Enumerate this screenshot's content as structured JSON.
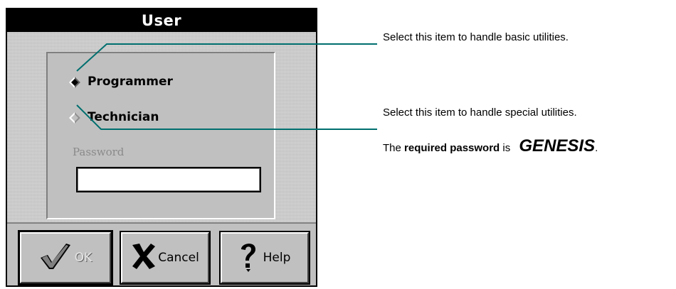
{
  "dialog": {
    "title": "User",
    "options": [
      {
        "label": "Programmer",
        "selected": true
      },
      {
        "label": "Technician",
        "selected": false
      }
    ],
    "password": {
      "label": "Password",
      "value": ""
    },
    "buttons": {
      "ok": "OK",
      "cancel": "Cancel",
      "help": "Help"
    }
  },
  "callouts": {
    "programmer_note": "Select this item to handle basic utilities.",
    "technician_note": "Select this item to handle special utilities.",
    "password_note": {
      "prefix": "The ",
      "emphasis": "required password",
      "middle": " is ",
      "password": "GENESIS",
      "suffix": "."
    }
  },
  "colors": {
    "leader_line": "#006f6f",
    "dialog_bg": "#c0c0c0",
    "titlebar": "#000000"
  }
}
